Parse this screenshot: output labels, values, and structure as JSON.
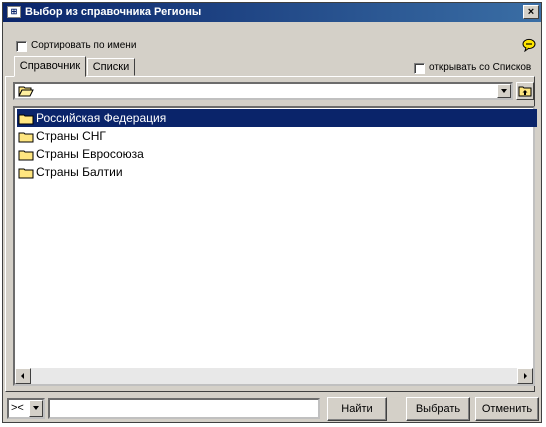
{
  "window": {
    "title": "Выбор из справочника Регионы",
    "close_symbol": "×"
  },
  "options": {
    "sort_by_name_label": "Сортировать по имени",
    "sort_by_name_checked": false,
    "open_with_lists_label": "открывать со Списков",
    "open_with_lists_checked": false
  },
  "tabs": [
    {
      "label": "Справочник",
      "active": true
    },
    {
      "label": "Списки",
      "active": false
    }
  ],
  "path_combo": {
    "value": ""
  },
  "tree": {
    "items": [
      {
        "label": "Российская Федерация",
        "selected": true
      },
      {
        "label": "Страны СНГ",
        "selected": false
      },
      {
        "label": "Страны Евросоюза",
        "selected": false
      },
      {
        "label": "Страны Балтии",
        "selected": false
      }
    ]
  },
  "footer": {
    "operator_value": "><",
    "search_value": "",
    "find_label": "Найти",
    "select_label": "Выбрать",
    "cancel_label": "Отменить"
  },
  "colors": {
    "selection": "#0a246a",
    "titlebar": "#0a246a",
    "folder": "#ffe680"
  }
}
